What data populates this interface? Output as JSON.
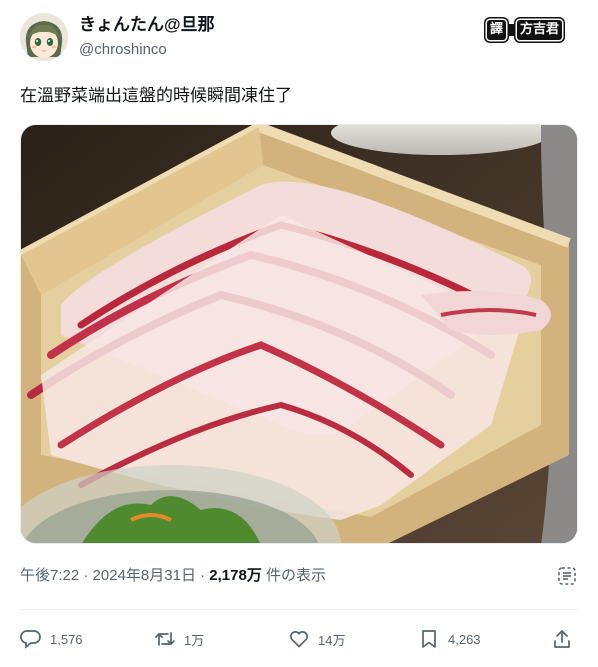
{
  "user": {
    "display_name": "きょんたん@旦那",
    "handle": "@chroshinco",
    "avatar": "anime-girl-avatar"
  },
  "watermark": {
    "left": "譯",
    "right": "方吉君"
  },
  "tweet": {
    "text": "在溫野菜端出這盤的時候瞬間凍住了"
  },
  "media": {
    "description_icon": "photo-sliced-pork-in-wooden-box"
  },
  "meta": {
    "time": "午後7:22",
    "separator": " · ",
    "date": "2024年8月31日",
    "views_count": "2,178万",
    "views_label": " 件の表示"
  },
  "actions": {
    "reply_count": "1,576",
    "retweet_count": "1万",
    "like_count": "14万",
    "bookmark_count": "4,263"
  },
  "colors": {
    "text": "#0f1419",
    "secondary": "#536471",
    "divider": "#eff3f4"
  }
}
